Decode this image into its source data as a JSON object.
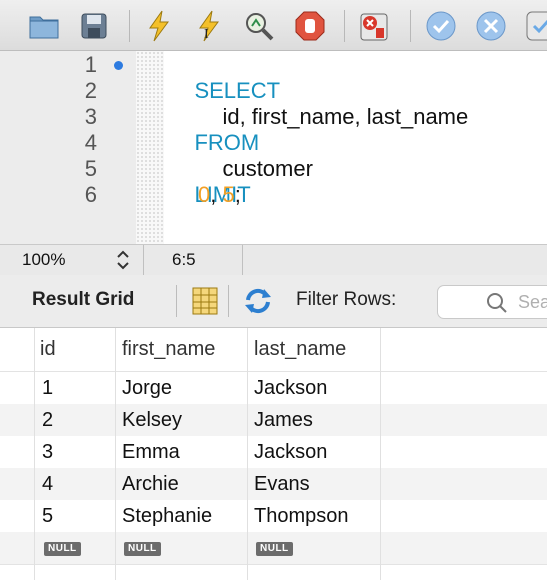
{
  "toolbar": {
    "buttons": [
      {
        "icon": "folder-icon"
      },
      {
        "icon": "save-icon"
      },
      {
        "icon": "execute-lightning-icon"
      },
      {
        "icon": "execute-current-lightning-icon"
      },
      {
        "icon": "explain-magnifier-icon"
      },
      {
        "icon": "stop-hand-icon"
      },
      {
        "icon": "toggle-stop-on-error-icon"
      },
      {
        "icon": "commit-check-icon"
      },
      {
        "icon": "rollback-x-icon"
      },
      {
        "icon": "autocommit-icon"
      }
    ],
    "colors": {
      "accent": "#1790bf",
      "number": "#f3a025",
      "check": "#6aa9e6"
    }
  },
  "editor": {
    "line_numbers": [
      "1",
      "2",
      "3",
      "4",
      "5",
      "6"
    ],
    "lines": [
      {
        "keyword": "SELECT"
      },
      {
        "text": "id, first_name, last_name"
      },
      {
        "keyword": "FROM"
      },
      {
        "text": "customer"
      },
      {
        "keyword": "LIMIT"
      },
      {
        "num1": "0",
        "sep": ", ",
        "num2": "5",
        "end": ";"
      }
    ]
  },
  "status": {
    "zoom": "100%",
    "position": "6:5"
  },
  "result": {
    "title": "Result Grid",
    "filter_label": "Filter Rows:",
    "search_placeholder": "Sea"
  },
  "grid": {
    "columns": [
      "id",
      "first_name",
      "last_name"
    ],
    "rows": [
      [
        "1",
        "Jorge",
        "Jackson"
      ],
      [
        "2",
        "Kelsey",
        "James"
      ],
      [
        "3",
        "Emma",
        "Jackson"
      ],
      [
        "4",
        "Archie",
        "Evans"
      ],
      [
        "5",
        "Stephanie",
        "Thompson"
      ]
    ],
    "null_label": "NULL"
  }
}
